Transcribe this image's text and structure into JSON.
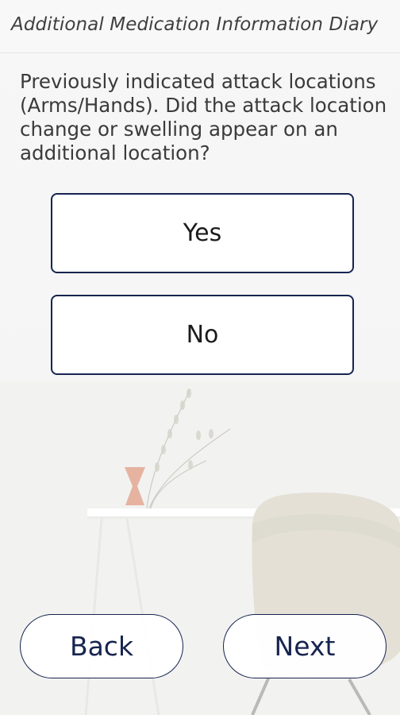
{
  "header": {
    "title": "Additional Medication Information Diary"
  },
  "question": {
    "text": "Previously indicated attack locations (Arms/Hands). Did the attack location change or swelling appear on an additional location?"
  },
  "options": [
    {
      "label": "Yes"
    },
    {
      "label": "No"
    }
  ],
  "navigation": {
    "back_label": "Back",
    "next_label": "Next"
  },
  "colors": {
    "accent": "#16244f",
    "text": "#3a3a3a"
  }
}
